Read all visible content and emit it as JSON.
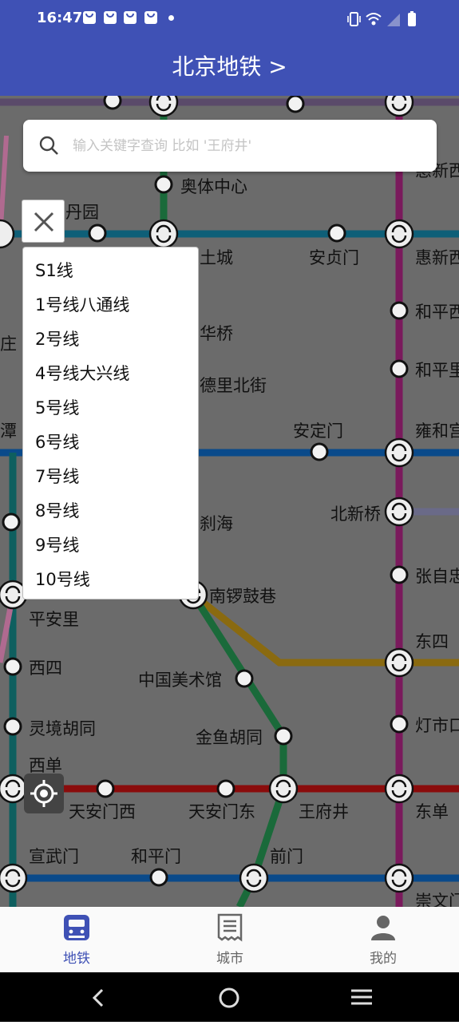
{
  "status_bar": {
    "time": "16:47"
  },
  "app_bar": {
    "title": "北京地铁 >"
  },
  "search": {
    "placeholder": "输入关键字查询 比如 '王府井'"
  },
  "line_list": [
    "S1线",
    "1号线八通线",
    "2号线",
    "4号线大兴线",
    "5号线",
    "6号线",
    "7号线",
    "8号线",
    "9号线",
    "10号线"
  ],
  "stations": {
    "aoti": "奥体中心",
    "danyuan": "丹园",
    "tucheng": "土城",
    "anzhenmen": "安贞门",
    "huixinxi1": "惠新西",
    "huixinxi2": "惠新西",
    "hepingxi": "和平西",
    "hepingli": "和平里",
    "zhuang": "庄",
    "huaqiao": "华桥",
    "deshengmen": "德里北街",
    "tan": "潭",
    "andingmen": "安定门",
    "yonghe": "雍和宫",
    "beixinqiao": "北新桥",
    "shihai": "刹海",
    "zhangzizhong": "张自忠",
    "nanluogu": "南锣鼓巷",
    "pinganli": "平安里",
    "dongsi": "东四",
    "xisi": "西四",
    "meishuguan": "中国美术馆",
    "dengshikou": "灯市口",
    "lingjing": "灵境胡同",
    "jinyu": "金鱼胡同",
    "xidan": "西单",
    "tiananmenxi": "天安门西",
    "tiananmendong": "天安门东",
    "wangfujing": "王府井",
    "dongdan": "东单",
    "xuanwumen": "宣武门",
    "hepingmen": "和平门",
    "qianmen": "前门",
    "chongwenmen": "崇文门"
  },
  "bottom_nav": [
    {
      "label": "地铁",
      "icon": "subway-icon"
    },
    {
      "label": "城市",
      "icon": "document-icon"
    },
    {
      "label": "我的",
      "icon": "profile-icon"
    }
  ],
  "colors": {
    "primary": "#3f51b5",
    "line2": "#0a4a8a",
    "line5": "#7a1a5c",
    "line6": "#8a6a10",
    "line8": "#1a6a3a",
    "line1": "#8a0c0c",
    "line10": "#0e5f78"
  }
}
